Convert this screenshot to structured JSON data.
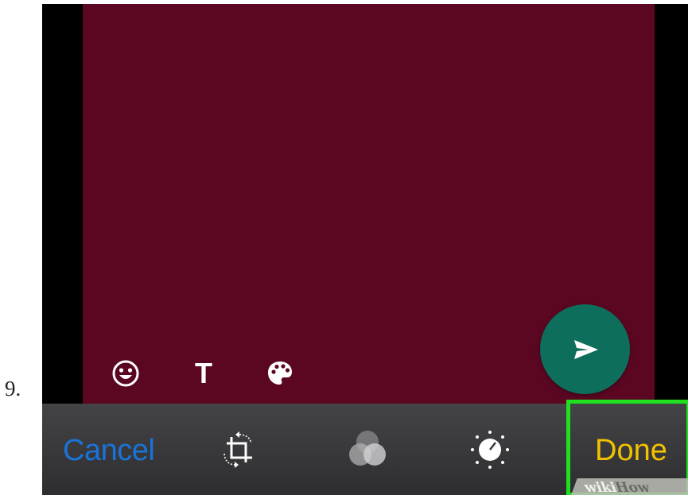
{
  "step": {
    "number": "9."
  },
  "editor": {
    "photo_color": "#5b0722",
    "tools": [
      {
        "icon": "emoji-icon"
      },
      {
        "icon": "text-icon",
        "label": "T"
      },
      {
        "icon": "palette-icon"
      }
    ],
    "send": {
      "icon": "send-icon",
      "color": "#0d6e5b"
    }
  },
  "toolbar": {
    "cancel_label": "Cancel",
    "done_label": "Done",
    "icons": [
      "crop-rotate-icon",
      "filters-icon",
      "adjust-icon"
    ],
    "cancel_color": "#1a73d8",
    "done_color": "#f2c200",
    "highlight_color": "#1ee01e"
  },
  "watermark": {
    "wiki": "wiki",
    "how": "How"
  }
}
